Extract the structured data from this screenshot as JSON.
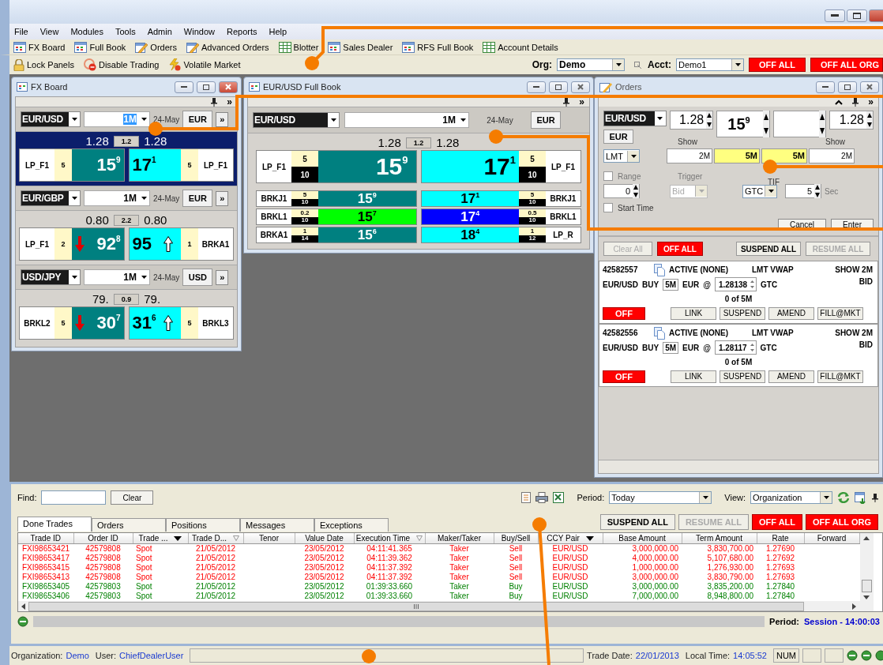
{
  "menu": [
    "File",
    "View",
    "Modules",
    "Tools",
    "Admin",
    "Window",
    "Reports",
    "Help"
  ],
  "toolbar": [
    "FX Board",
    "Full Book",
    "Orders",
    "Advanced Orders",
    "Blotter",
    "Sales Dealer",
    "RFS Full Book",
    "Account Details"
  ],
  "toolbar2": [
    "Lock Panels",
    "Disable Trading",
    "Volatile Market"
  ],
  "org": {
    "label": "Org:",
    "value": "Demo"
  },
  "acct": {
    "label": "Acct:",
    "value": "Demo1"
  },
  "kill_buttons": [
    "OFF ALL",
    "OFF ALL ORG"
  ],
  "fx_board": {
    "title": "FX Board",
    "more": "»",
    "tiles": [
      {
        "pair": "EUR/USD",
        "tenor": "1M",
        "tenor_selected": true,
        "date": "24-May",
        "ccy": "EUR",
        "more": "»",
        "bid_big": "1.28",
        "spread": "1.2",
        "ask_big": "1.28",
        "selected": true,
        "bid": {
          "lp": "LP_F1",
          "size": "5",
          "pips": "15",
          "frac": "9",
          "arrow": false
        },
        "ask": {
          "lp": "LP_F1",
          "size": "5",
          "pips": "17",
          "frac": "1",
          "arrow": false
        }
      },
      {
        "pair": "EUR/GBP",
        "tenor": "1M",
        "tenor_selected": false,
        "date": "24-May",
        "ccy": "EUR",
        "more": "»",
        "bid_big": "0.80",
        "spread": "2.2",
        "ask_big": "0.80",
        "selected": false,
        "bid": {
          "lp": "LP_F1",
          "size": "2",
          "pips": "92",
          "frac": "8",
          "arrow": true
        },
        "ask": {
          "lp": "BRKA1",
          "size": "1",
          "pips": "95",
          "arrow": true
        }
      },
      {
        "pair": "USD/JPY",
        "tenor": "1M",
        "tenor_selected": false,
        "date": "24-May",
        "ccy": "USD",
        "more": "»",
        "bid_big": "79.",
        "spread": "0.9",
        "ask_big": "79.",
        "selected": false,
        "bid": {
          "lp": "BRKL2",
          "size": "5",
          "pips": "30",
          "frac": "7",
          "arrow": true
        },
        "ask": {
          "lp": "BRKL3",
          "size": "5",
          "pips": "31",
          "frac": "6",
          "arrow": true
        }
      }
    ]
  },
  "full_book": {
    "title": "EUR/USD Full Book",
    "more": "»",
    "pair": "EUR/USD",
    "tenor": "1M",
    "date": "24-May",
    "ccy": "EUR",
    "bid_big": "1.28",
    "spread": "1.2",
    "ask_big": "1.28",
    "top": {
      "bid": {
        "lp": "LP_F1",
        "size": "5",
        "max": "10",
        "pips": "15",
        "frac": "9"
      },
      "ask": {
        "lp": "LP_F1",
        "size": "5",
        "max": "10",
        "pips": "17",
        "frac": "1"
      }
    },
    "levels": [
      {
        "bid": {
          "lp": "BRKJ1",
          "size": "5",
          "max": "10",
          "pips": "15",
          "frac": "9",
          "color": "#008080"
        },
        "ask": {
          "lp": "BRKJ1",
          "size": "5",
          "max": "10",
          "pips": "17",
          "frac": "1",
          "color": "#00ffff"
        }
      },
      {
        "bid": {
          "lp": "BRKL1",
          "size": "0.2",
          "max": "10",
          "pips": "15",
          "frac": "7",
          "color": "#00ff00"
        },
        "ask": {
          "lp": "BRKL1",
          "size": "0.5",
          "max": "10",
          "pips": "17",
          "frac": "4",
          "color": "#0000ff"
        }
      },
      {
        "bid": {
          "lp": "BRKA1",
          "size": "1",
          "max": "14",
          "pips": "15",
          "frac": "6",
          "color": "#008080"
        },
        "ask": {
          "lp": "LP_R",
          "size": "1",
          "max": "12",
          "pips": "18",
          "frac": "4",
          "color": "#00ffff"
        }
      }
    ]
  },
  "orders": {
    "title": "Orders",
    "more": "»",
    "ticket": {
      "pair": "EUR/USD",
      "bid_price": "1.28",
      "pips": "15",
      "frac": "9",
      "ask_price": "1.28",
      "ccy": "EUR",
      "order_type": "LMT",
      "show_labels": [
        "Show",
        "Show"
      ],
      "sizes": [
        {
          "value": "2M",
          "highlighted": false
        },
        {
          "value": "5M",
          "highlighted": true
        },
        {
          "value": "5M",
          "highlighted": true
        },
        {
          "value": "2M",
          "highlighted": false
        }
      ],
      "range": {
        "label": "Range",
        "checked": false,
        "value": "0"
      },
      "trigger": {
        "label": "Trigger",
        "value": "Bid",
        "disabled": true
      },
      "tif": {
        "label": "TIF",
        "value": "GTC",
        "seconds": "5",
        "unit": "Sec"
      },
      "start_time": {
        "label": "Start Time",
        "checked": false
      },
      "buttons": [
        "Cancel",
        "Enter"
      ]
    },
    "actions": [
      {
        "label": "Clear All",
        "kind": "plain",
        "disabled": true
      },
      {
        "label": "OFF ALL",
        "kind": "kill",
        "disabled": false
      },
      {
        "label": "SUSPEND ALL",
        "kind": "plain",
        "disabled": false
      },
      {
        "label": "RESUME ALL",
        "kind": "plain",
        "disabled": true
      }
    ],
    "list": [
      {
        "id": "42582557",
        "status": "ACTIVE (NONE)",
        "type": "LMT VWAP",
        "show": "SHOW 2M",
        "pair": "EUR/USD",
        "side": "BUY",
        "qty": "5M",
        "ccy": "EUR",
        "at": "@",
        "price": "1.28138",
        "tif": "GTC",
        "book_side": "BID",
        "filled": "0 of 5M",
        "off": "OFF",
        "buttons": [
          "LINK",
          "SUSPEND",
          "AMEND",
          "FILL@MKT"
        ]
      },
      {
        "id": "42582556",
        "status": "ACTIVE (NONE)",
        "type": "LMT VWAP",
        "show": "SHOW 2M",
        "pair": "EUR/USD",
        "side": "BUY",
        "qty": "5M",
        "ccy": "EUR",
        "at": "@",
        "price": "1.28117",
        "tif": "GTC",
        "book_side": "BID",
        "filled": "0 of 5M",
        "off": "OFF",
        "buttons": [
          "LINK",
          "SUSPEND",
          "AMEND",
          "FILL@MKT"
        ]
      }
    ]
  },
  "blotter": {
    "find_label": "Find:",
    "clear": "Clear",
    "period_label": "Period:",
    "period": "Today",
    "view_label": "View:",
    "view": "Organization",
    "tabs": [
      {
        "label": "Done Trades",
        "selected": true
      },
      {
        "label": "Orders",
        "selected": false
      },
      {
        "label": "Positions",
        "selected": false
      },
      {
        "label": "Messages",
        "selected": false
      },
      {
        "label": "Exceptions",
        "selected": false
      }
    ],
    "actions": [
      {
        "label": "SUSPEND ALL",
        "kind": "plain",
        "disabled": false
      },
      {
        "label": "RESUME ALL",
        "kind": "plain",
        "disabled": true
      },
      {
        "label": "OFF ALL",
        "kind": "kill",
        "disabled": false
      },
      {
        "label": "OFF ALL ORG",
        "kind": "kill",
        "disabled": false
      }
    ],
    "columns": [
      {
        "label": "Trade ID",
        "dropdown": false,
        "filtered": false
      },
      {
        "label": "Order ID",
        "dropdown": false,
        "filtered": false
      },
      {
        "label": "Trade ...",
        "dropdown": true,
        "filtered": false
      },
      {
        "label": "Trade D...",
        "dropdown": false,
        "filtered": true
      },
      {
        "label": "Tenor",
        "dropdown": false,
        "filtered": false
      },
      {
        "label": "Value Date",
        "dropdown": false,
        "filtered": false
      },
      {
        "label": "Execution Time",
        "dropdown": false,
        "filtered": true
      },
      {
        "label": "Maker/Taker",
        "dropdown": false,
        "filtered": false
      },
      {
        "label": "Buy/Sell",
        "dropdown": false,
        "filtered": false
      },
      {
        "label": "CCY Pair",
        "dropdown": true,
        "filtered": false
      },
      {
        "label": "Base Amount",
        "dropdown": false,
        "filtered": false
      },
      {
        "label": "Term Amount",
        "dropdown": false,
        "filtered": false
      },
      {
        "label": "Rate",
        "dropdown": false,
        "filtered": false
      },
      {
        "label": "Forward",
        "dropdown": false,
        "filtered": false
      }
    ],
    "rows": [
      {
        "trade_id": "FXI98653421",
        "order_id": "42579808",
        "type": "Spot",
        "trade_date": "21/05/2012",
        "value_date": "23/05/2012",
        "exec_time": "04:11:41.365",
        "maker_taker": "Taker",
        "side": "Sell",
        "pair": "EUR/USD",
        "base": "3,000,000.00",
        "term": "3,830,700.00",
        "rate": "1.27690",
        "color": "#ff0000"
      },
      {
        "trade_id": "FXI98653417",
        "order_id": "42579808",
        "type": "Spot",
        "trade_date": "21/05/2012",
        "value_date": "23/05/2012",
        "exec_time": "04:11:39.362",
        "maker_taker": "Taker",
        "side": "Sell",
        "pair": "EUR/USD",
        "base": "4,000,000.00",
        "term": "5,107,680.00",
        "rate": "1.27692",
        "color": "#ff0000"
      },
      {
        "trade_id": "FXI98653415",
        "order_id": "42579808",
        "type": "Spot",
        "trade_date": "21/05/2012",
        "value_date": "23/05/2012",
        "exec_time": "04:11:37.392",
        "maker_taker": "Taker",
        "side": "Sell",
        "pair": "EUR/USD",
        "base": "1,000,000.00",
        "term": "1,276,930.00",
        "rate": "1.27693",
        "color": "#ff0000"
      },
      {
        "trade_id": "FXI98653413",
        "order_id": "42579808",
        "type": "Spot",
        "trade_date": "21/05/2012",
        "value_date": "23/05/2012",
        "exec_time": "04:11:37.392",
        "maker_taker": "Taker",
        "side": "Sell",
        "pair": "EUR/USD",
        "base": "3,000,000.00",
        "term": "3,830,790.00",
        "rate": "1.27693",
        "color": "#ff0000"
      },
      {
        "trade_id": "FXI98653405",
        "order_id": "42579803",
        "type": "Spot",
        "trade_date": "21/05/2012",
        "value_date": "23/05/2012",
        "exec_time": "01:39:33.660",
        "maker_taker": "Taker",
        "side": "Buy",
        "pair": "EUR/USD",
        "base": "3,000,000.00",
        "term": "3,835,200.00",
        "rate": "1.27840",
        "color": "#008000"
      },
      {
        "trade_id": "FXI98653406",
        "order_id": "42579803",
        "type": "Spot",
        "trade_date": "21/05/2012",
        "value_date": "23/05/2012",
        "exec_time": "01:39:33.660",
        "maker_taker": "Taker",
        "side": "Buy",
        "pair": "EUR/USD",
        "base": "7,000,000.00",
        "term": "8,948,800.00",
        "rate": "1.27840",
        "color": "#008000"
      }
    ],
    "footer": {
      "label": "Period:",
      "value": "Session - 14:00:03"
    }
  },
  "status": {
    "org_label": "Organization:",
    "org": "Demo",
    "user_label": "User:",
    "user": "ChiefDealerUser",
    "date_label": "Trade Date:",
    "date": "22/01/2013",
    "time_label": "Local Time:",
    "time": "14:05:52",
    "num": "NUM"
  }
}
